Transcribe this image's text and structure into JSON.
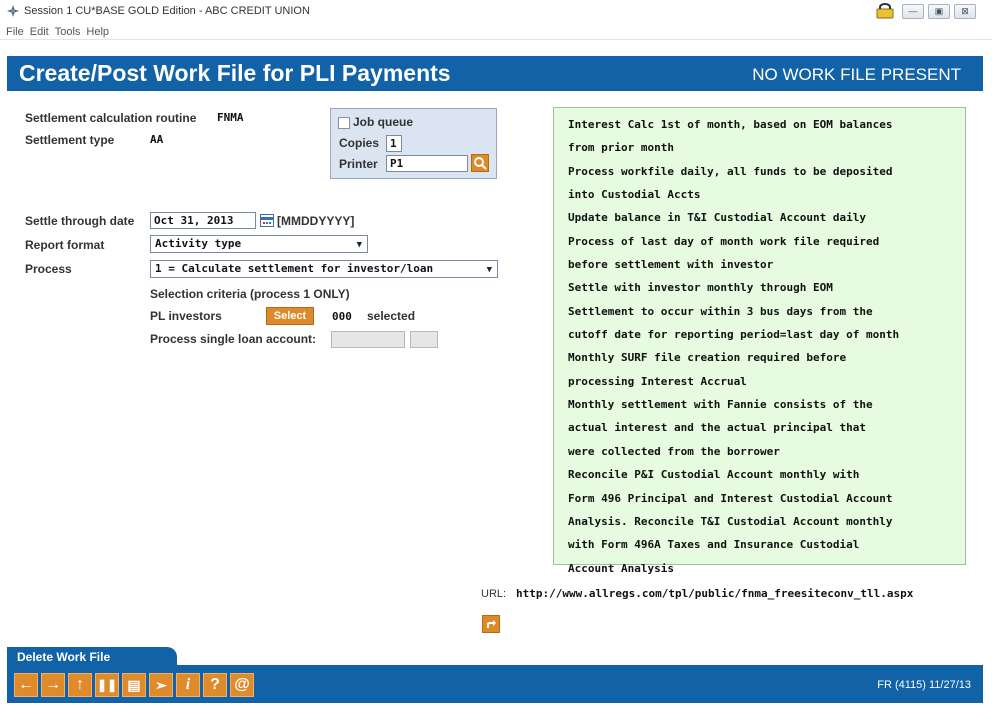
{
  "window": {
    "title": "Session 1 CU*BASE GOLD Edition - ABC CREDIT UNION",
    "controls": [
      "minimize",
      "restore",
      "close"
    ]
  },
  "menu": [
    "File",
    "Edit",
    "Tools",
    "Help"
  ],
  "header": {
    "title": "Create/Post Work File for PLI Payments",
    "status": "NO WORK FILE PRESENT"
  },
  "form": {
    "routine_label": "Settlement calculation routine",
    "routine_value": "FNMA",
    "type_label": "Settlement type",
    "type_value": "AA",
    "job_queue_label": "Job queue",
    "job_queue_checked": false,
    "copies_label": "Copies",
    "copies_value": "1",
    "printer_label": "Printer",
    "printer_value": "P1",
    "settle_label": "Settle through date",
    "settle_value": "Oct 31, 2013",
    "date_format": "[MMDDYYYY]",
    "report_label": "Report format",
    "report_value": "Activity type",
    "process_label": "Process",
    "process_value": "1 = Calculate settlement for investor/loan",
    "selection_label": "Selection criteria (process 1 ONLY)",
    "pl_label": "PL investors",
    "select_button": "Select",
    "selected_count": "000",
    "selected_label": "selected",
    "single_loan_label": "Process single loan account:",
    "single_loan_value": ""
  },
  "notes": [
    "Interest Calc 1st of month, based on EOM balances",
    "from prior month",
    "Process workfile daily, all funds to be deposited",
    "into Custodial Accts",
    "Update balance in T&I Custodial Account daily",
    "Process of last day of month work file required",
    "before settlement with investor",
    "Settle with investor monthly through EOM",
    "Settlement to occur within 3 bus days from the",
    "cutoff date for reporting period=last day of month",
    "Monthly SURF file creation required before",
    "processing Interest Accrual",
    "Monthly settlement with Fannie consists of the",
    "actual interest and the actual principal that",
    "were collected from the borrower",
    "Reconcile P&I Custodial Account monthly with",
    "Form 496 Principal and Interest Custodial Account",
    "Analysis.  Reconcile T&I Custodial Account monthly",
    "with Form 496A Taxes and Insurance Custodial",
    "Account Analysis"
  ],
  "url": {
    "label": "URL:",
    "value": "http://www.allregs.com/tpl/public/fnma_freesiteconv_tll.aspx"
  },
  "tabs": {
    "delete": "Delete Work File"
  },
  "toolbar": [
    "back-arrow-icon",
    "forward-arrow-icon",
    "up-arrow-icon",
    "pause-icon",
    "print-icon",
    "link-icon",
    "info-icon",
    "help-icon",
    "email-icon"
  ],
  "footer": {
    "code": "FR (4115) 11/27/13"
  },
  "colors": {
    "header_blue": "#1162a6",
    "accent_orange": "#dd8a2a",
    "notes_green": "#e6fbe0"
  }
}
